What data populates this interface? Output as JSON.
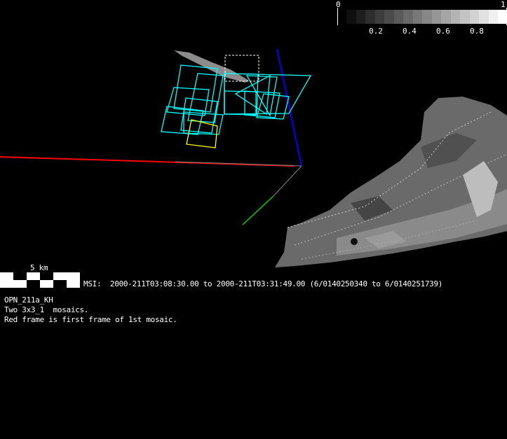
{
  "colorbar": {
    "min_label": "0",
    "max_label": "1",
    "ticks": [
      "0.2",
      "0.4",
      "0.6",
      "0.8"
    ],
    "range": [
      0,
      1
    ],
    "steps": 17
  },
  "scale_bar": {
    "label": "5 km"
  },
  "msi_line": "MSI:  2000-211T03:08:30.00 to 2000-211T03:31:49.00 (6/0140250340 to 6/0140251739)",
  "notes": [
    "OPN_211a_KH",
    "Two 3x3_1  mosaics.",
    "Red frame is first frame of 1st mosaic."
  ],
  "colors": {
    "frames": "#00ffff",
    "highlight": "#ffff00",
    "x_axis": "#ff0000",
    "y_axis": "#00cc00",
    "z_axis": "#0000ff",
    "first_frame": "#ff00ff"
  }
}
